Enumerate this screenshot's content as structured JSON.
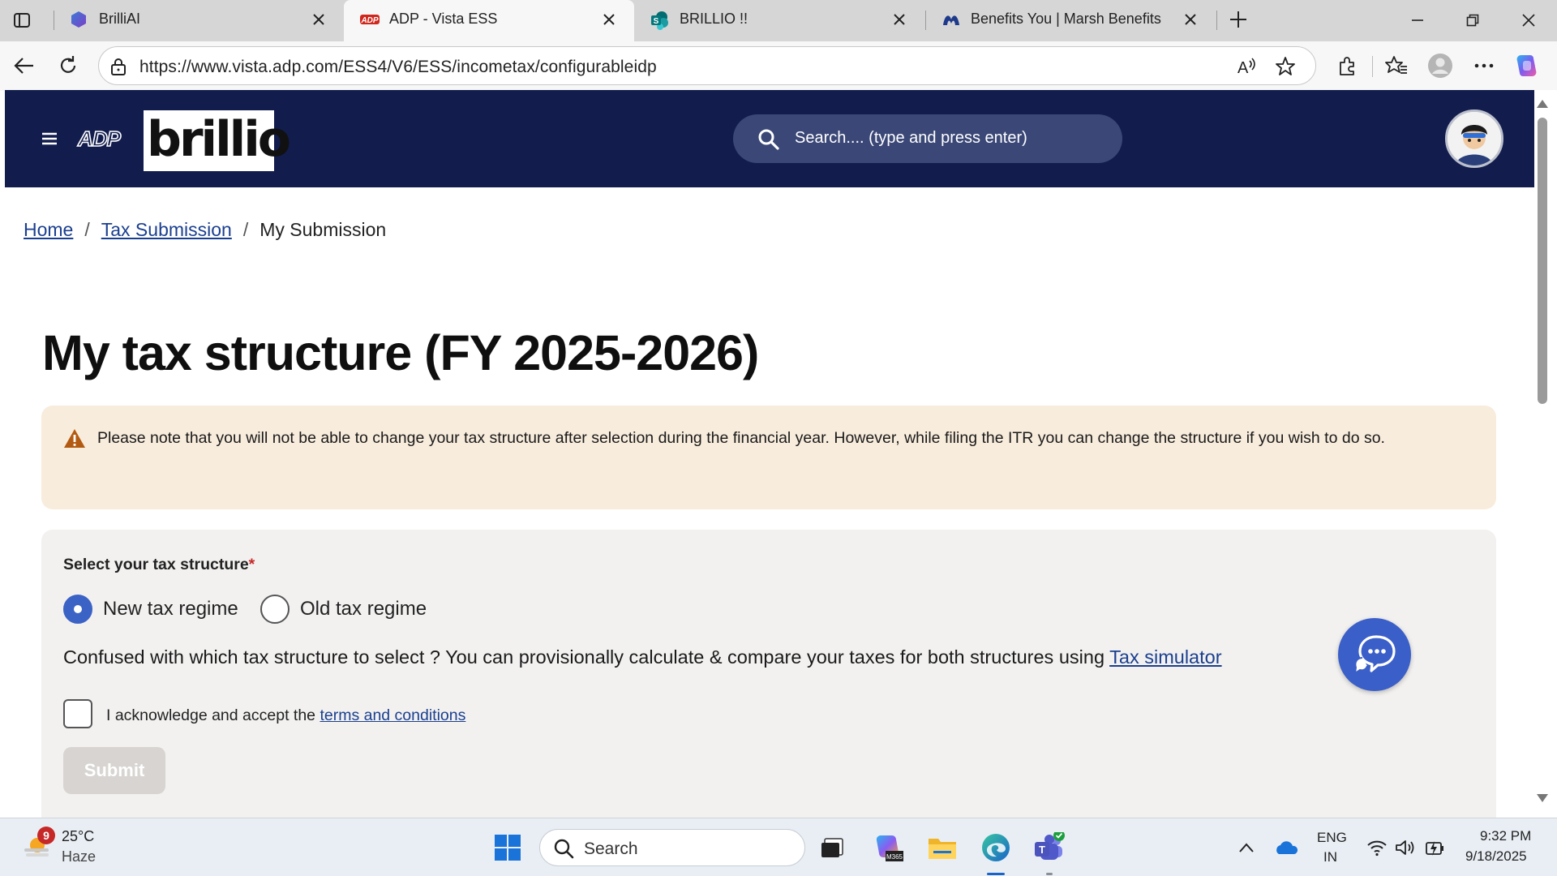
{
  "browser": {
    "tabs": [
      {
        "title": "BrilliAI",
        "active": false
      },
      {
        "title": "ADP - Vista ESS",
        "active": true
      },
      {
        "title": "BRILLIO !!",
        "active": false
      },
      {
        "title": "Benefits You | Marsh Benefits",
        "active": false
      }
    ],
    "url": "https://www.vista.adp.com/ESS4/V6/ESS/incometax/configurableidp"
  },
  "header": {
    "logo_text": "brillio",
    "search_placeholder": "Search.... (type and press enter)"
  },
  "breadcrumb": {
    "home": "Home",
    "tax_submission": "Tax Submission",
    "current": "My Submission",
    "separator": "/"
  },
  "page": {
    "title": "My tax structure (FY 2025-2026)",
    "warning": "Please note that you will not be able to change your tax structure after selection during the financial year. However, while filing the ITR you can change the structure if you wish to do so."
  },
  "form": {
    "select_label": "Select your tax structure",
    "required_mark": "*",
    "options": [
      {
        "label": "New tax regime",
        "selected": true
      },
      {
        "label": "Old tax regime",
        "selected": false
      }
    ],
    "confused_text": "Confused with which tax structure to select ? You can provisionally calculate & compare your taxes for both structures using ",
    "simulator_link": "Tax simulator",
    "ack_text": "I acknowledge and accept the ",
    "terms_link": "terms and conditions",
    "ack_checked": false,
    "submit_label": "Submit",
    "submit_enabled": false
  },
  "taskbar": {
    "weather_badge": "9",
    "temperature": "25°C",
    "condition": "Haze",
    "search_label": "Search",
    "lang_primary": "ENG",
    "lang_secondary": "IN",
    "time": "9:32 PM",
    "date": "9/18/2025"
  },
  "colors": {
    "header_bg": "#121d4e",
    "warning_bg": "#f8ecdc",
    "accent": "#3b62c5",
    "link": "#1a3f8f"
  }
}
